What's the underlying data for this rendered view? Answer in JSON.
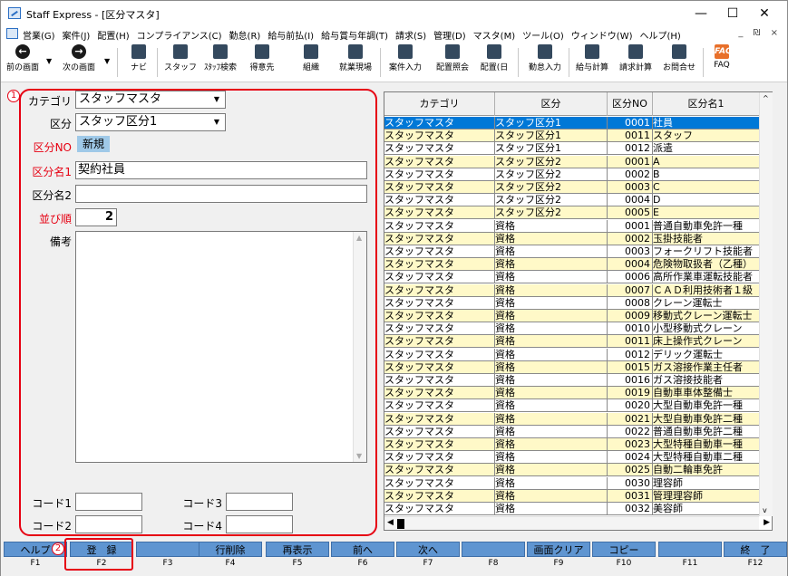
{
  "window": {
    "title": "Staff Express - [区分マスタ]",
    "minimize": "—",
    "maximize": "☐",
    "close": "✕"
  },
  "menu": [
    "営業(G)",
    "案件(J)",
    "配置(H)",
    "コンプライアンス(C)",
    "勤怠(R)",
    "給与前払(I)",
    "給与賞与年調(T)",
    "請求(S)",
    "管理(D)",
    "マスタ(M)",
    "ツール(O)",
    "ウィンドウ(W)",
    "ヘルプ(H)"
  ],
  "mdi_controls": "_ ₪ ×",
  "toolbar": {
    "back": "前の画面",
    "forward": "次の画面",
    "navi": "ナビ",
    "staff": "スタッフ",
    "staff_search": "ｽﾀｯﾌ検索",
    "client": "得意先",
    "org": "組織",
    "site": "就業現場",
    "case_input": "案件入力",
    "placement_ref": "配置照会",
    "placement_day": "配置(日",
    "attendance_input": "勤怠入力",
    "pay_calc": "給与計算",
    "bill_calc": "請求計算",
    "inquiry": "お問合せ",
    "faq": "FAQ",
    "faq_icon": "FAQ"
  },
  "annotations": {
    "one": "1",
    "two": "2"
  },
  "form": {
    "category_label": "カテゴリ",
    "category_value": "スタッフマスタ",
    "kubun_label": "区分",
    "kubun_value": "スタッフ区分1",
    "kubun_no_label": "区分NO",
    "kubun_no_value": "新規",
    "name1_label": "区分名1",
    "name1_value": "契約社員",
    "name2_label": "区分名2",
    "name2_value": "",
    "order_label": "並び順",
    "order_value": "2",
    "memo_label": "備考",
    "code1_label": "コード1",
    "code2_label": "コード2",
    "code3_label": "コード3",
    "code4_label": "コード4"
  },
  "grid": {
    "columns": [
      "カテゴリ",
      "区分",
      "区分NO",
      "区分名1"
    ],
    "rows": [
      [
        "スタッフマスタ",
        "スタッフ区分1",
        "0001",
        "社員"
      ],
      [
        "スタッフマスタ",
        "スタッフ区分1",
        "0011",
        "スタッフ"
      ],
      [
        "スタッフマスタ",
        "スタッフ区分1",
        "0012",
        "派遣"
      ],
      [
        "スタッフマスタ",
        "スタッフ区分2",
        "0001",
        "A"
      ],
      [
        "スタッフマスタ",
        "スタッフ区分2",
        "0002",
        "B"
      ],
      [
        "スタッフマスタ",
        "スタッフ区分2",
        "0003",
        "C"
      ],
      [
        "スタッフマスタ",
        "スタッフ区分2",
        "0004",
        "D"
      ],
      [
        "スタッフマスタ",
        "スタッフ区分2",
        "0005",
        "E"
      ],
      [
        "スタッフマスタ",
        "資格",
        "0001",
        "普通自動車免許一種"
      ],
      [
        "スタッフマスタ",
        "資格",
        "0002",
        "玉掛技能者"
      ],
      [
        "スタッフマスタ",
        "資格",
        "0003",
        "フォークリフト技能者"
      ],
      [
        "スタッフマスタ",
        "資格",
        "0004",
        "危険物取扱者（乙種）"
      ],
      [
        "スタッフマスタ",
        "資格",
        "0006",
        "高所作業車運転技能者"
      ],
      [
        "スタッフマスタ",
        "資格",
        "0007",
        "ＣＡＤ利用技術者１級"
      ],
      [
        "スタッフマスタ",
        "資格",
        "0008",
        "クレーン運転士"
      ],
      [
        "スタッフマスタ",
        "資格",
        "0009",
        "移動式クレーン運転士"
      ],
      [
        "スタッフマスタ",
        "資格",
        "0010",
        "小型移動式クレーン"
      ],
      [
        "スタッフマスタ",
        "資格",
        "0011",
        "床上操作式クレーン"
      ],
      [
        "スタッフマスタ",
        "資格",
        "0012",
        "デリック運転士"
      ],
      [
        "スタッフマスタ",
        "資格",
        "0015",
        "ガス溶接作業主任者"
      ],
      [
        "スタッフマスタ",
        "資格",
        "0016",
        "ガス溶接技能者"
      ],
      [
        "スタッフマスタ",
        "資格",
        "0019",
        "自動車車体整備士"
      ],
      [
        "スタッフマスタ",
        "資格",
        "0020",
        "大型自動車免許一種"
      ],
      [
        "スタッフマスタ",
        "資格",
        "0021",
        "大型自動車免許二種"
      ],
      [
        "スタッフマスタ",
        "資格",
        "0022",
        "普通自動車免許二種"
      ],
      [
        "スタッフマスタ",
        "資格",
        "0023",
        "大型特種自動車一種"
      ],
      [
        "スタッフマスタ",
        "資格",
        "0024",
        "大型特種自動車二種"
      ],
      [
        "スタッフマスタ",
        "資格",
        "0025",
        "自動二輪車免許"
      ],
      [
        "スタッフマスタ",
        "資格",
        "0030",
        "理容師"
      ],
      [
        "スタッフマスタ",
        "資格",
        "0031",
        "管理理容師"
      ],
      [
        "スタッフマスタ",
        "資格",
        "0032",
        "美容師"
      ]
    ]
  },
  "fkeys": [
    {
      "label": "ヘルプ",
      "key": "F1"
    },
    {
      "label": "登　録",
      "key": "F2"
    },
    {
      "label": "",
      "key": "F3"
    },
    {
      "label": "行削除",
      "key": "F4"
    },
    {
      "label": "再表示",
      "key": "F5"
    },
    {
      "label": "前へ",
      "key": "F6"
    },
    {
      "label": "次へ",
      "key": "F7"
    },
    {
      "label": "",
      "key": "F8"
    },
    {
      "label": "画面クリア",
      "key": "F9"
    },
    {
      "label": "コピー",
      "key": "F10"
    },
    {
      "label": "",
      "key": "F11"
    },
    {
      "label": "終　了",
      "key": "F12"
    }
  ]
}
